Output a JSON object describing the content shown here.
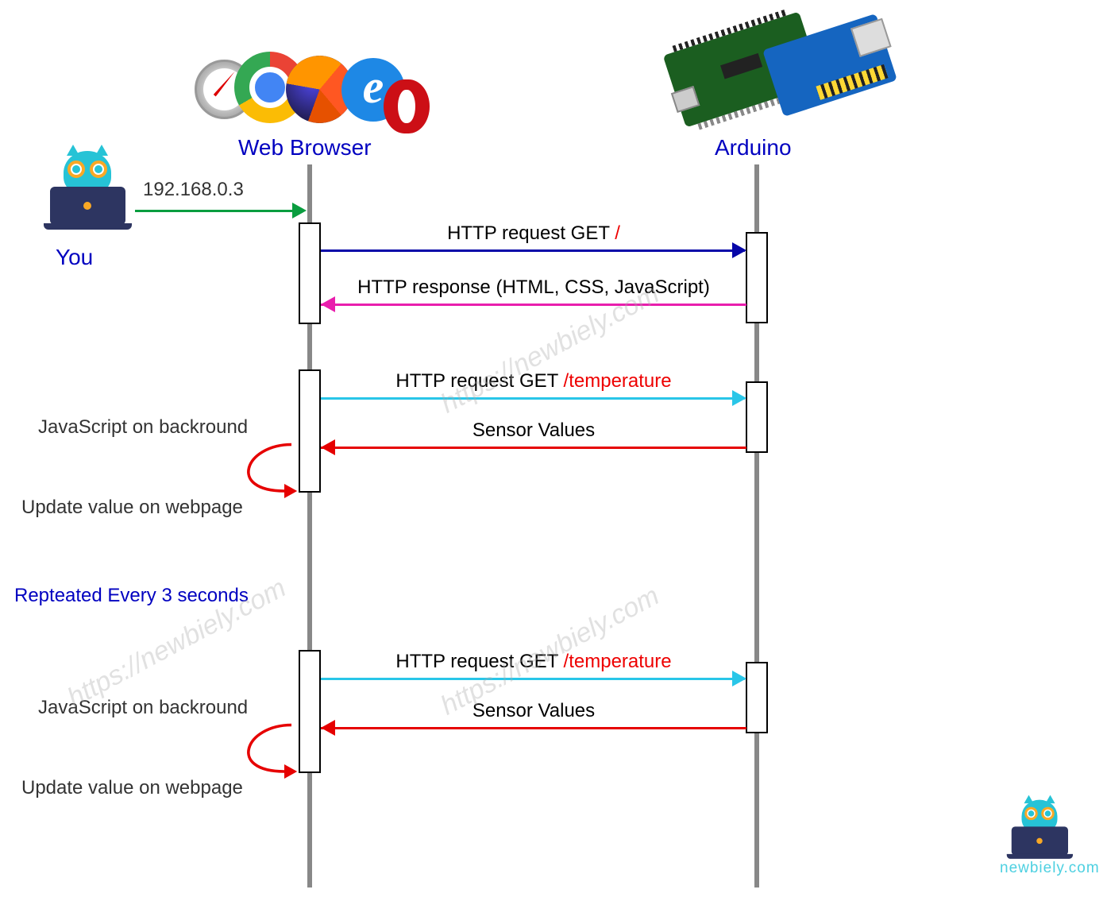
{
  "participants": {
    "you": "You",
    "browser": "Web Browser",
    "arduino": "Arduino"
  },
  "ip_address": "192.168.0.3",
  "messages": {
    "req_root": {
      "prefix": "HTTP request GET ",
      "path": "/"
    },
    "resp_html": "HTTP response (HTML, CSS, JavaScript)",
    "req_temp1": {
      "prefix": "HTTP request GET ",
      "path": "/temperature"
    },
    "resp_sensor1": "Sensor Values",
    "req_temp2": {
      "prefix": "HTTP request GET ",
      "path": "/temperature"
    },
    "resp_sensor2": "Sensor Values"
  },
  "side_labels": {
    "js_bg1": "JavaScript on backround",
    "update1": "Update value on webpage",
    "repeated": "Repteated Every 3 seconds",
    "js_bg2": "JavaScript on backround",
    "update2": "Update value on webpage"
  },
  "watermark": "https://newbiely.com",
  "logo": "newbiely.com"
}
